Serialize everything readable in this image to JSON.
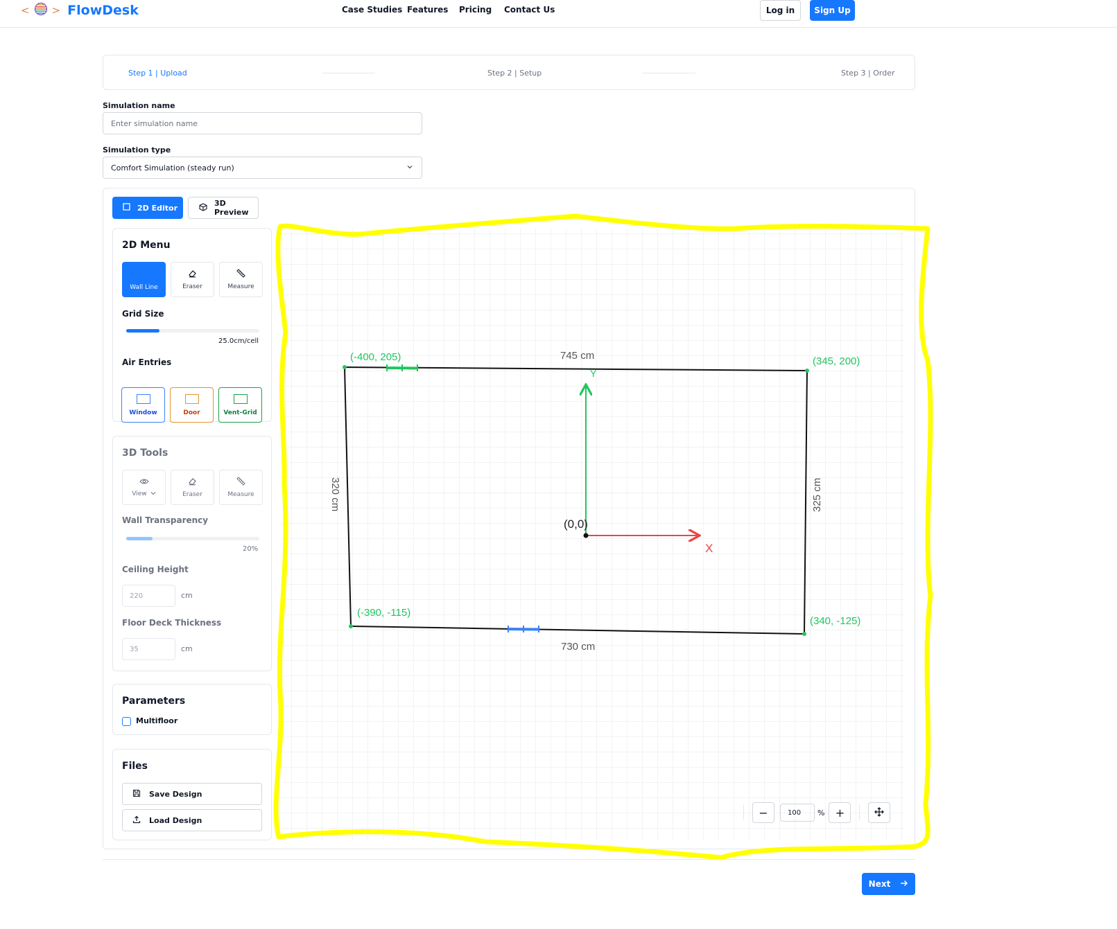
{
  "brand": {
    "name": "FlowDesk",
    "logo_left": "<",
    "logo_right": ">"
  },
  "nav": [
    "Case Studies",
    "Features",
    "Pricing",
    "Contact Us"
  ],
  "auth": {
    "login": "Log in",
    "signup": "Sign Up"
  },
  "steps": [
    "Step 1 | Upload",
    "Step 2 | Setup",
    "Step 3 | Order"
  ],
  "form": {
    "name_label": "Simulation name",
    "name_placeholder": "Enter simulation name",
    "type_label": "Simulation type",
    "type_value": "Comfort Simulation (steady run)"
  },
  "tabs": {
    "editor": "2D Editor",
    "preview": "3D Preview"
  },
  "menu2d": {
    "title": "2D Menu",
    "tools": [
      "Wall Line",
      "Eraser",
      "Measure"
    ],
    "grid_title": "Grid Size",
    "grid_value": "25.0cm/cell",
    "grid_level": 0.25,
    "air_title": "Air Entries",
    "entries": [
      "Window",
      "Door",
      "Vent-Grid"
    ]
  },
  "tools3d": {
    "title": "3D Tools",
    "tools": [
      "View",
      "Eraser",
      "Measure"
    ],
    "transparency_title": "Wall Transparency",
    "transparency_value": "20%",
    "transparency_level": 0.2,
    "ceiling_title": "Ceiling Height",
    "ceiling_value": "220",
    "floor_title": "Floor Deck Thickness",
    "floor_value": "35",
    "unit": "cm"
  },
  "params": {
    "title": "Parameters",
    "multifloor": "Multifloor"
  },
  "files": {
    "title": "Files",
    "save": "Save Design",
    "load": "Load Design"
  },
  "canvas": {
    "corners": [
      "(-400, 205)",
      "(345, 200)",
      "(-390, -115)",
      "(340, -125)"
    ],
    "dims": [
      "745 cm",
      "730 cm",
      "320 cm",
      "325 cm"
    ],
    "origin": "(0,0)",
    "x_axis": "X",
    "y_axis": "Y",
    "colors": {
      "wall": "#111111",
      "point": "#22c55e",
      "window": "#22c55e",
      "door": "#3b82f6",
      "x_axis": "#ef4444",
      "y_axis": "#22c55e"
    }
  },
  "zoom": {
    "value": "100",
    "unit": "%"
  },
  "next": "Next",
  "colors": {
    "accent": "#1677ff",
    "door": "#e0952a",
    "vent": "#16a34a",
    "annotation": "#ffff00"
  }
}
